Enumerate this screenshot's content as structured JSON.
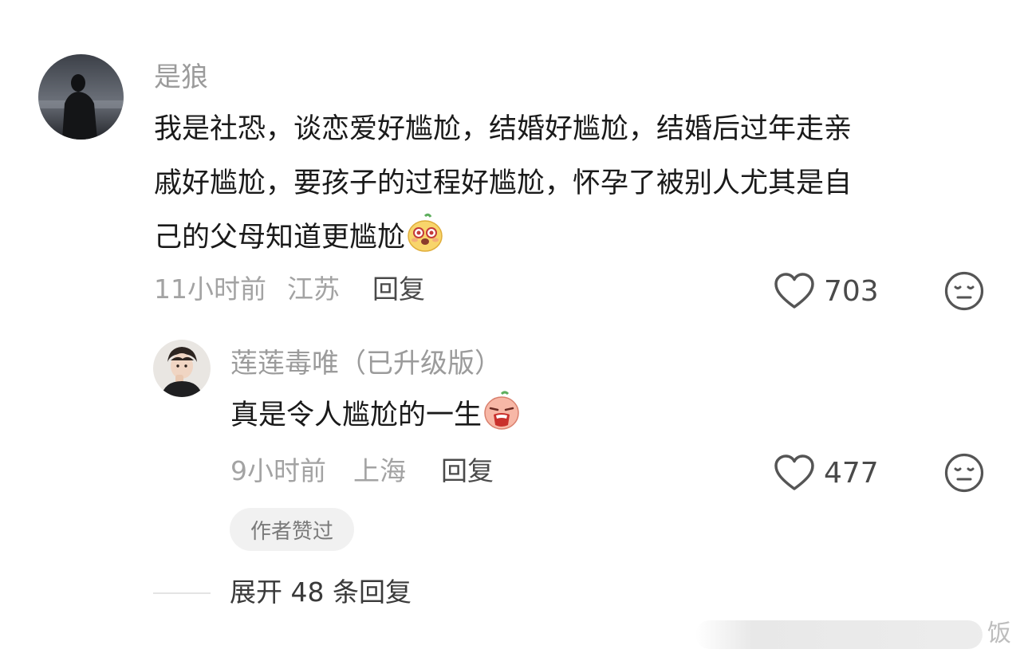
{
  "comments": [
    {
      "username": "是狼",
      "text_lines": [
        "我是社恐，谈恋爱好尴尬，结婚好尴尬，结婚后过年走亲",
        "戚好尴尬，要孩子的过程好尴尬，怀孕了被别人尤其是自",
        "己的父母知道更尴尬"
      ],
      "emoji": "laughing-face-emoji",
      "time": "11小时前",
      "location": "江苏",
      "reply_label": "回复",
      "likes": "703"
    }
  ],
  "reply": {
    "username": "莲莲毒唯（已升级版）",
    "text": "真是令人尴尬的一生",
    "emoji": "crying-face-emoji",
    "time": "9小时前",
    "location": "上海",
    "reply_label": "回复",
    "likes": "477",
    "badge": "作者赞过"
  },
  "expand": {
    "label": "展开 48 条回复"
  },
  "watermark": "饭",
  "colors": {
    "username_gray": "#9b9b9b",
    "meta_gray": "#a3a3a3",
    "icon_gray": "#555555",
    "badge_bg": "#f1f1f1"
  }
}
